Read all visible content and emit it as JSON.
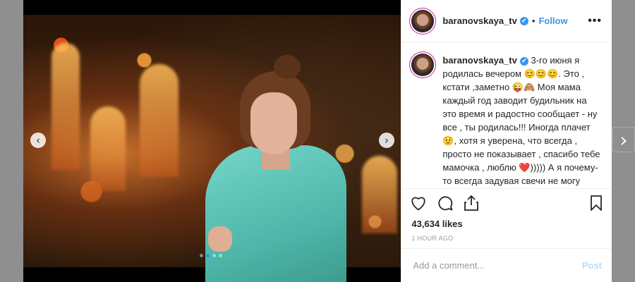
{
  "post": {
    "username": "baranovskaya_tv",
    "verified_mark": "✔",
    "separator": "•",
    "follow_label": "Follow",
    "more_label": "•••",
    "caption": "3-го июня я родилась вечером 😊😊😊. Это , кстати ,заметно 😜🙈 Моя мама каждый год заводит будильник на это время и радостно сообщает - ну все , ты родилась!!! Иногда плачет 😟, хотя я уверена, что всегда , просто не показывает , спасибо тебе мамочка , люблю ❤️))))) А я почему-то всегда задувая свечи не могу сообразить , что загадать , мысли",
    "likes": "43,634 likes",
    "time": "1 HOUR AGO",
    "comment_placeholder": "Add a comment...",
    "post_label": "Post"
  },
  "carousel": {
    "prev_arrow": "‹",
    "next_arrow": "›",
    "dots": 4,
    "active_dot": 1
  },
  "next_post_arrow": "›",
  "colors": {
    "accent": "#3897f0",
    "jacket": "#5cc4b7",
    "post_disabled": "#b2dffc"
  },
  "icons": [
    "heart-icon",
    "comment-icon",
    "share-icon",
    "bookmark-icon",
    "verified-icon"
  ]
}
